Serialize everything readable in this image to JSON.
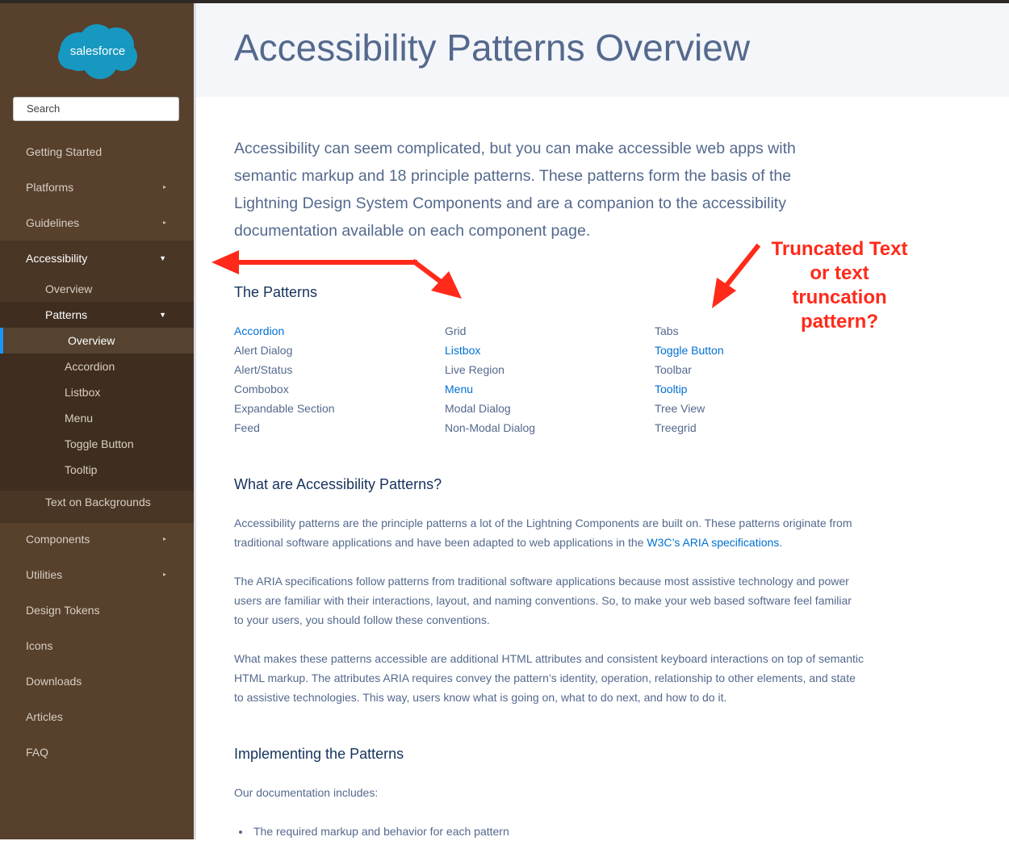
{
  "sidebar": {
    "logo_text": "salesforce",
    "search_placeholder": "Search",
    "items": [
      {
        "label": "Getting Started"
      },
      {
        "label": "Platforms"
      },
      {
        "label": "Guidelines"
      },
      {
        "label": "Accessibility"
      },
      {
        "label": "Overview"
      },
      {
        "label": "Patterns"
      },
      {
        "label": "Overview"
      },
      {
        "label": "Accordion"
      },
      {
        "label": "Listbox"
      },
      {
        "label": "Menu"
      },
      {
        "label": "Toggle Button"
      },
      {
        "label": "Tooltip"
      },
      {
        "label": "Text on Backgrounds"
      },
      {
        "label": "Components"
      },
      {
        "label": "Utilities"
      },
      {
        "label": "Design Tokens"
      },
      {
        "label": "Icons"
      },
      {
        "label": "Downloads"
      },
      {
        "label": "Articles"
      },
      {
        "label": "FAQ"
      }
    ]
  },
  "page": {
    "title": "Accessibility Patterns Overview",
    "intro": "Accessibility can seem complicated, but you can make accessible web apps with semantic markup and 18 principle patterns. These patterns form the basis of the Lightning Design System Components and are a companion to the accessibility documentation available on each component page.",
    "patterns_heading": "The Patterns",
    "patterns": [
      [
        {
          "label": "Accordion",
          "link": true
        },
        {
          "label": "Alert Dialog",
          "link": false
        },
        {
          "label": "Alert/Status",
          "link": false
        },
        {
          "label": "Combobox",
          "link": false
        },
        {
          "label": "Expandable Section",
          "link": false
        },
        {
          "label": "Feed",
          "link": false
        }
      ],
      [
        {
          "label": "Grid",
          "link": false
        },
        {
          "label": "Listbox",
          "link": true
        },
        {
          "label": "Live Region",
          "link": false
        },
        {
          "label": "Menu",
          "link": true
        },
        {
          "label": "Modal Dialog",
          "link": false
        },
        {
          "label": "Non-Modal Dialog",
          "link": false
        }
      ],
      [
        {
          "label": "Tabs",
          "link": false
        },
        {
          "label": "Toggle Button",
          "link": true
        },
        {
          "label": "Toolbar",
          "link": false
        },
        {
          "label": "Tooltip",
          "link": true
        },
        {
          "label": "Tree View",
          "link": false
        },
        {
          "label": "Treegrid",
          "link": false
        }
      ]
    ],
    "what_heading": "What are Accessibility Patterns?",
    "what_p1_a": "Accessibility patterns are the principle patterns a lot of the Lightning Components are built on. These patterns originate from traditional software applications and have been adapted to web applications in the ",
    "what_p1_link": "W3C’s ARIA specifications",
    "what_p1_b": ".",
    "what_p2": "The ARIA specifications follow patterns from traditional software applications because most assistive technology and power users are familiar with their interactions, layout, and naming conventions. So, to make your web based software feel familiar to your users, you should follow these conventions.",
    "what_p3": "What makes these patterns accessible are additional HTML attributes and consistent keyboard interactions on top of semantic HTML markup. The attributes ARIA requires convey the pattern’s identity, operation, relationship to other elements, and state to assistive technologies. This way, users know what is going on, what to do next, and how to do it.",
    "impl_heading": "Implementing the Patterns",
    "impl_p": "Our documentation includes:",
    "impl_bullet": "The required markup and behavior for each pattern"
  },
  "annotation": {
    "lines": [
      "Truncated Text",
      "or text",
      "truncation",
      "pattern?"
    ],
    "color": "#ff2a1a"
  },
  "colors": {
    "sidebar": "#57402c",
    "link": "#0070d2",
    "text": "#54698d",
    "heading": "#16325c"
  }
}
